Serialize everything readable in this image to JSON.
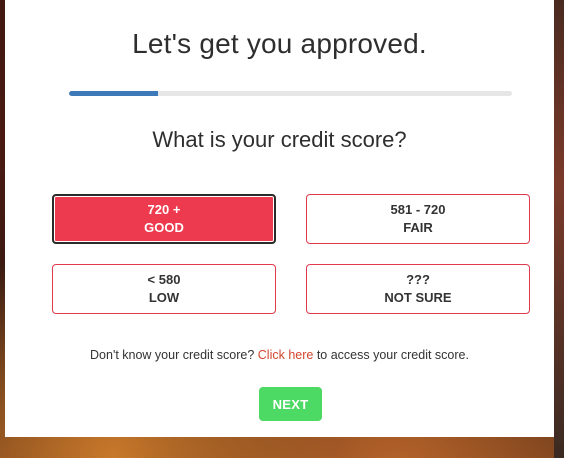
{
  "modal": {
    "title": "Let's get you approved.",
    "progress_fraction": 0.2,
    "question": "What is your credit score?",
    "options": [
      {
        "range": "720 +",
        "label": "GOOD",
        "selected": true
      },
      {
        "range": "581 - 720",
        "label": "FAIR",
        "selected": false
      },
      {
        "range": "< 580",
        "label": "LOW",
        "selected": false
      },
      {
        "range": "???",
        "label": "NOT SURE",
        "selected": false
      }
    ],
    "help": {
      "prefix": "Don't know your credit score?",
      "link": "Click here",
      "suffix": "to access your credit score."
    },
    "next_label": "NEXT"
  },
  "colors": {
    "accent_red": "#ee3a4e",
    "progress_blue": "#3d78b8",
    "next_green": "#4cd964",
    "link_orange": "#d2452e"
  }
}
